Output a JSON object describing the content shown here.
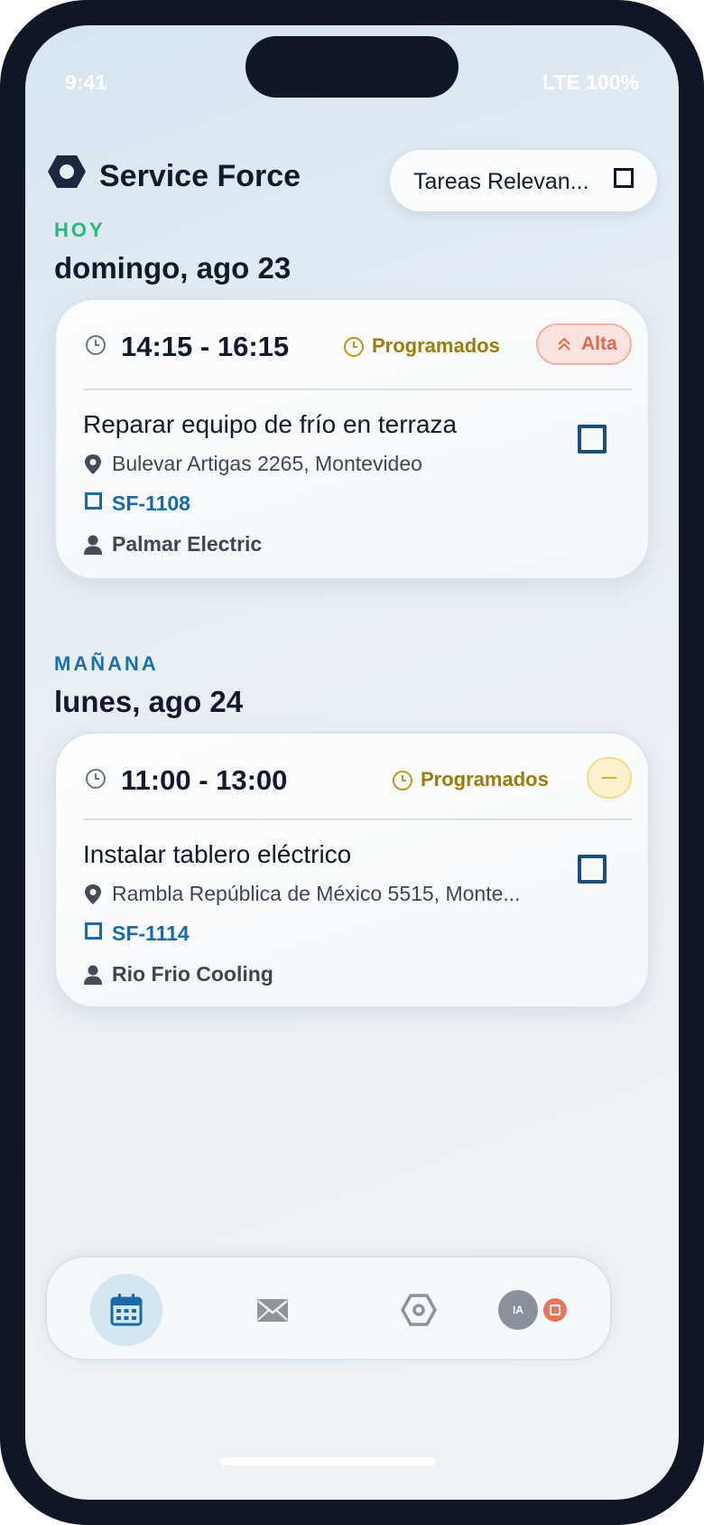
{
  "status_bar": {
    "time": "9:41",
    "right": "LTE 100%"
  },
  "header": {
    "app_title": "Service Force",
    "filter_label": "Tareas Relevan..."
  },
  "days": [
    {
      "tag": "HOY",
      "tag_color": "#2db57a",
      "date": "domingo, ago 23",
      "task": {
        "time": "14:15 - 16:15",
        "status": "Programados",
        "priority": "Alta",
        "title": "Reparar equipo de frío en terraza",
        "address": "Bulevar Artigas 2265, Montevideo",
        "ticket": "SF-1108",
        "client": "Palmar Electric"
      }
    },
    {
      "tag": "MAÑANA",
      "tag_color": "#1c6fa8",
      "date": "lunes, ago 24",
      "task": {
        "time": "11:00 - 13:00",
        "status": "Programados",
        "priority": "—",
        "title": "Instalar tablero eléctrico",
        "address": "Rambla República de México 5515, Monte...",
        "ticket": "SF-1114",
        "client": "Rio Frio Cooling"
      }
    }
  ],
  "nav": {
    "avatar_initials": "IA",
    "active": "calendar"
  },
  "colors": {
    "brand_dark": "#101a2c",
    "link_blue": "#1a6aa8",
    "status_gold": "#9a7b0c",
    "priority_high": "#e06a50",
    "stop_badge": "#e8765b"
  },
  "icons": [
    "hexagon-logo-icon",
    "checkbox-icon",
    "clock-icon",
    "chevrons-up-icon",
    "location-pin-icon",
    "ticket-icon",
    "person-icon",
    "calendar-icon",
    "mail-icon",
    "settings-hexagon-icon",
    "stop-icon"
  ]
}
